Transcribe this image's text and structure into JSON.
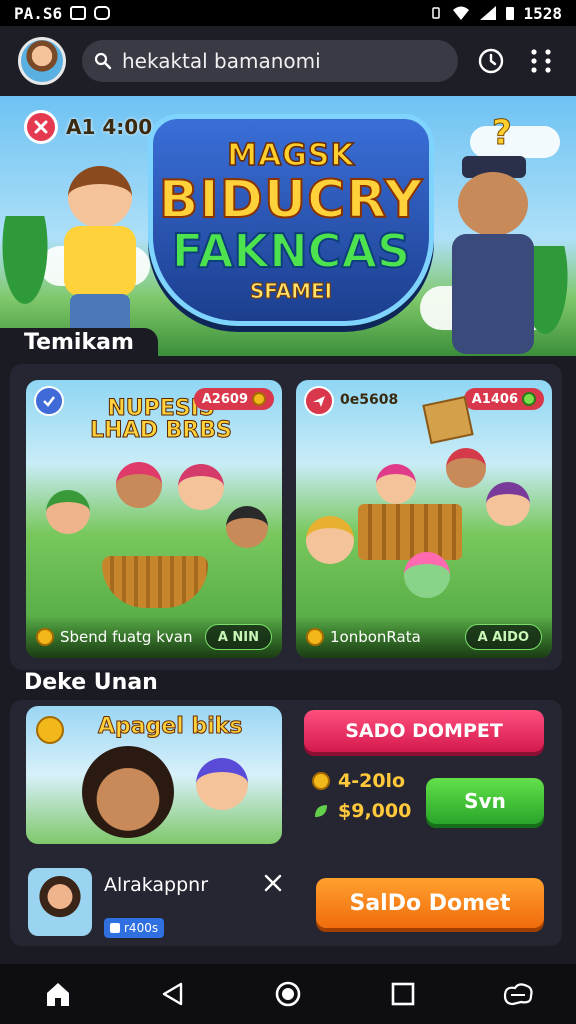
{
  "status_bar": {
    "left": "PA.S6",
    "time": "1528"
  },
  "header": {
    "search_text": "hekaktal bamanomi"
  },
  "hero": {
    "timer": "A1 4:00",
    "title_lines": [
      "MAGSK",
      "BIDUCRY",
      "FAKNCAS",
      "SFAMEI"
    ]
  },
  "section1": {
    "title": "Temikam"
  },
  "cards": [
    {
      "title": "NUPESIS LHAD BRBS",
      "tag": "A2609",
      "footer_label": "Sbend fuatg kvan",
      "footer_button": "A NIN"
    },
    {
      "title": "",
      "tag": "A1406",
      "left_tag": "0e5608",
      "footer_label": "1onbonRata",
      "footer_button": "A AIDO"
    }
  ],
  "section2": {
    "title": "Deke Unan"
  },
  "promo": {
    "title": "Apagel biks"
  },
  "wallet": {
    "button_label": "SADO DOMPET",
    "balance_1": "4-20lo",
    "balance_2": "$9,000",
    "action_label": "Svn"
  },
  "notification": {
    "title": "Alrakappnr",
    "badge": "r400s",
    "action_label": "SalDo Domet"
  },
  "colors": {
    "accent_pink": "#e0275a",
    "accent_green": "#3bbf35",
    "accent_orange": "#f5861a",
    "background": "#1b1b24"
  }
}
